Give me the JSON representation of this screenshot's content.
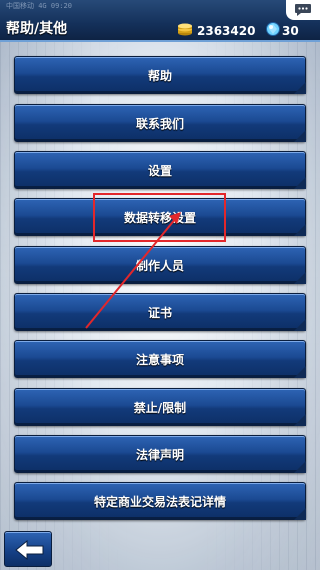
{
  "header": {
    "status_faint": "中国移动 4G 09:20",
    "title": "帮助/其他",
    "coins": "2363420",
    "gems": "30",
    "coin_icon": "coin-stack-icon",
    "gem_icon": "gem-orb-icon",
    "chat_icon": "chat-bubble-icon"
  },
  "menu": {
    "items": [
      {
        "label": "帮助"
      },
      {
        "label": "联系我们"
      },
      {
        "label": "设置"
      },
      {
        "label": "数据转移设置"
      },
      {
        "label": "制作人员"
      },
      {
        "label": "证书"
      },
      {
        "label": "注意事项"
      },
      {
        "label": "禁止/限制"
      },
      {
        "label": "法律声明"
      },
      {
        "label": "特定商业交易法表记详情"
      }
    ]
  },
  "annotation": {
    "highlight_color": "#e2272b",
    "target": "数据转移设置"
  },
  "footer": {
    "back_icon": "back-arrow-icon"
  },
  "colors": {
    "button_top": "#2e64b4",
    "button_bottom": "#0d2f66",
    "header": "#14305a"
  }
}
